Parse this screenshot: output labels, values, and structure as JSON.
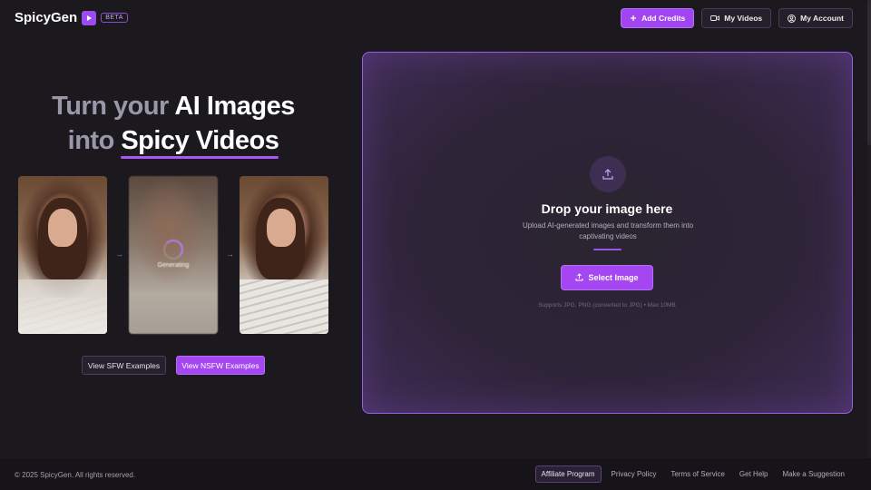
{
  "header": {
    "brand": "SpicyGen",
    "beta": "BETA",
    "nav": {
      "add_credits": "Add Credits",
      "my_videos": "My Videos",
      "my_account": "My Account"
    }
  },
  "hero": {
    "line1_muted": "Turn your ",
    "line1_white": "AI Images",
    "line2_muted": "into ",
    "line2_white": "Spicy Videos"
  },
  "examples": {
    "generating": "Generating",
    "sfw_button": "View SFW Examples",
    "nsfw_button": "View NSFW Examples"
  },
  "dropzone": {
    "title": "Drop your image here",
    "description": "Upload AI-generated images and transform them into captivating videos",
    "select_button": "Select Image",
    "note": "Supports JPG, PNG (converted to JPG) • Max 10MB"
  },
  "footer": {
    "copyright": "© 2025 SpicyGen. All rights reserved.",
    "links": [
      "Affiliate Program",
      "Privacy Policy",
      "Terms of Service",
      "Get Help",
      "Make a Suggestion"
    ]
  },
  "colors": {
    "accent": "#a447f2",
    "background": "#1b191d"
  },
  "icons": [
    "play-icon",
    "plus-icon",
    "video-camera-icon",
    "user-circle-icon",
    "upload-icon",
    "arrow-right-icon"
  ]
}
